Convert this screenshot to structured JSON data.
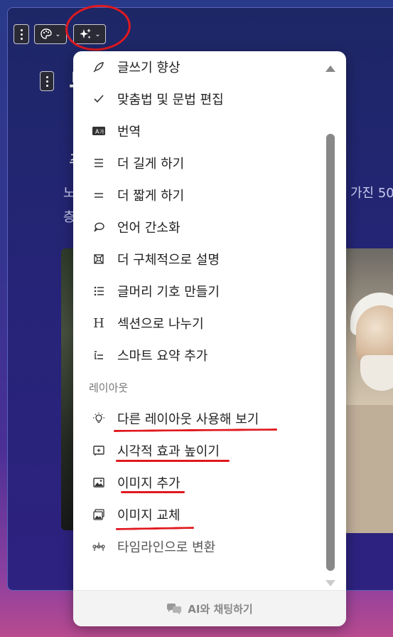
{
  "slide": {
    "title": "무",
    "subtitle": "주",
    "body_line1": "노",
    "body_line2": "층",
    "body_right": "가진 50"
  },
  "menu": {
    "items": [
      {
        "label": "글쓰기 향상",
        "icon": "feather-pen-icon"
      },
      {
        "label": "맞춤법 및 문법 편집",
        "icon": "checkmark-icon"
      },
      {
        "label": "번역",
        "icon": "translate-icon"
      },
      {
        "label": "더 길게 하기",
        "icon": "lines-expand-icon"
      },
      {
        "label": "더 짧게 하기",
        "icon": "lines-shorten-icon"
      },
      {
        "label": "언어 간소화",
        "icon": "speech-bubble-icon"
      },
      {
        "label": "더 구체적으로 설명",
        "icon": "focus-icon"
      },
      {
        "label": "글머리 기호 만들기",
        "icon": "bullet-list-icon"
      },
      {
        "label": "섹션으로 나누기",
        "icon": "heading-icon"
      },
      {
        "label": "스마트 요약 추가",
        "icon": "summary-list-icon"
      }
    ],
    "section_label": "레이아웃",
    "layout_items": [
      {
        "label": "다른 레이아웃 사용해 보기",
        "icon": "lightbulb-icon"
      },
      {
        "label": "시각적 효과 높이기",
        "icon": "sparkle-image-icon"
      },
      {
        "label": "이미지 추가",
        "icon": "image-icon"
      },
      {
        "label": "이미지 교체",
        "icon": "image-replace-icon"
      },
      {
        "label": "타임라인으로 변환",
        "icon": "timeline-icon"
      }
    ],
    "chat_label": "AI와 채팅하기"
  },
  "colors": {
    "annotation_red": "#e0191f",
    "menu_background": "#ffffff",
    "slide_background": "#1d2766"
  }
}
